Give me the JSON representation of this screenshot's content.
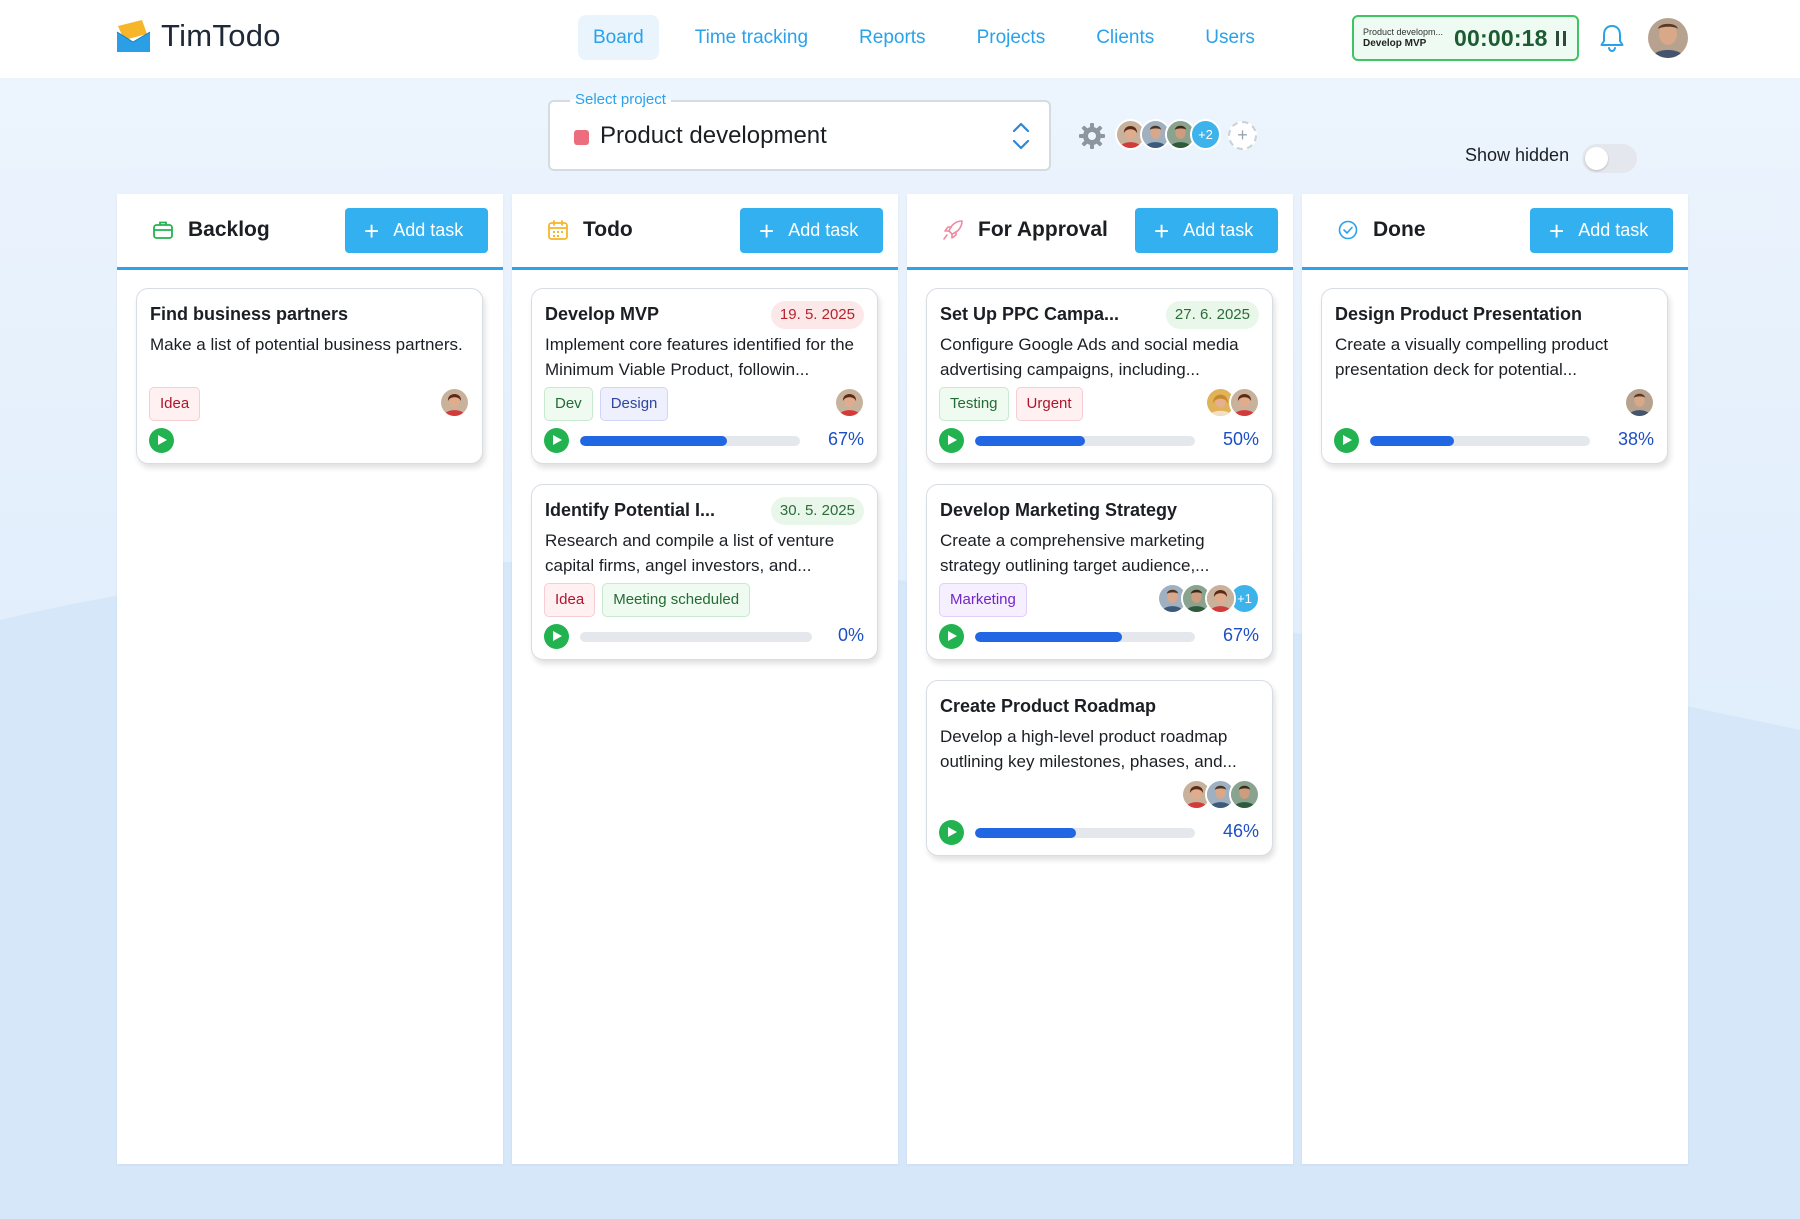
{
  "app": {
    "name": "TimTodo"
  },
  "nav": [
    {
      "label": "Board",
      "active": true
    },
    {
      "label": "Time tracking",
      "active": false
    },
    {
      "label": "Reports",
      "active": false
    },
    {
      "label": "Projects",
      "active": false
    },
    {
      "label": "Clients",
      "active": false
    },
    {
      "label": "Users",
      "active": false
    }
  ],
  "timer": {
    "project": "Product developm...",
    "task": "Develop MVP",
    "time": "00:00:18",
    "icon": "pause-icon"
  },
  "project_select": {
    "label": "Select project",
    "value": "Product development",
    "color": "#ec6d7d"
  },
  "members": {
    "more": "+2"
  },
  "show_hidden": {
    "label": "Show hidden",
    "on": false
  },
  "colors": {
    "accent": "#32b0ef",
    "progress": "#2166e3",
    "play": "#22b350"
  },
  "columns": [
    {
      "title": "Backlog",
      "icon": "briefcase-icon",
      "add_label": "Add task",
      "cards": [
        {
          "title": "Find business partners",
          "date": "",
          "desc": "Make a list of potential business partners.",
          "tags": [
            "Idea"
          ],
          "progress": null
        }
      ]
    },
    {
      "title": "Todo",
      "icon": "calendar-icon",
      "add_label": "Add task",
      "cards": [
        {
          "title": "Develop MVP",
          "date": "19. 5. 2025",
          "desc": "Implement core features identified for the Minimum Viable Product, followin...",
          "tags": [
            "Dev",
            "Design"
          ],
          "progress": 67,
          "progress_label": "67%"
        },
        {
          "title": "Identify Potential I...",
          "date": "30. 5. 2025",
          "desc": "Research and compile a list of venture capital firms, angel investors, and...",
          "tags": [
            "Idea",
            "Meeting scheduled"
          ],
          "progress": 0,
          "progress_label": "0%"
        }
      ]
    },
    {
      "title": "For Approval",
      "icon": "rocket-icon",
      "add_label": "Add task",
      "cards": [
        {
          "title": "Set Up PPC Campa...",
          "date": "27. 6. 2025",
          "desc": "Configure Google Ads and social media advertising campaigns, including...",
          "tags": [
            "Testing",
            "Urgent"
          ],
          "progress": 50,
          "progress_label": "50%"
        },
        {
          "title": "Develop Marketing Strategy",
          "date": "",
          "desc": "Create a comprehensive marketing strategy outlining target audience,...",
          "tags": [
            "Marketing"
          ],
          "more_assignees": "+1",
          "progress": 67,
          "progress_label": "67%"
        },
        {
          "title": "Create Product Roadmap",
          "date": "",
          "desc": "Develop a high-level product roadmap outlining key milestones, phases, and...",
          "tags": [],
          "progress": 46,
          "progress_label": "46%"
        }
      ]
    },
    {
      "title": "Done",
      "icon": "check-circle-icon",
      "add_label": "Add task",
      "cards": [
        {
          "title": "Design Product Presentation",
          "date": "",
          "desc": "Create a visually compelling product presentation deck for potential...",
          "tags": [],
          "progress": 38,
          "progress_label": "38%"
        }
      ]
    }
  ]
}
